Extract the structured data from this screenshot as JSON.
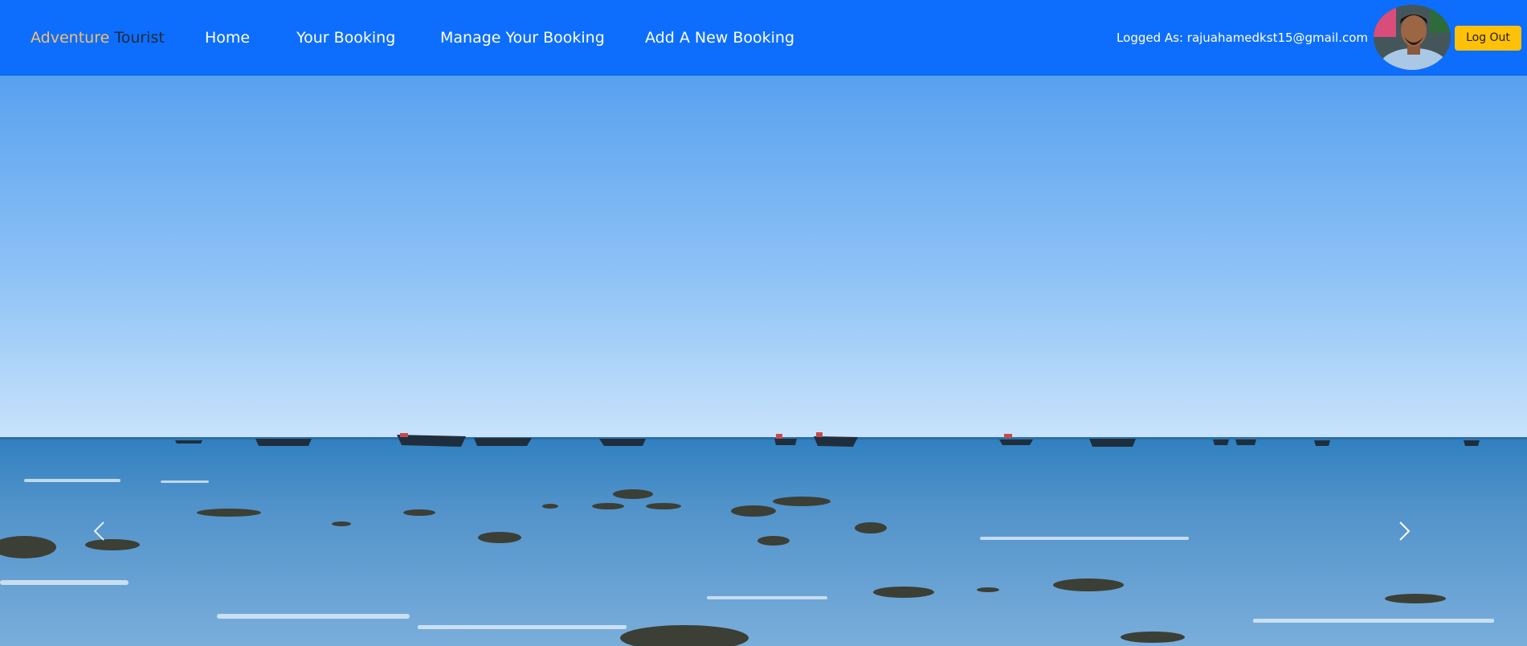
{
  "nav": {
    "brand_part1": "Adventure",
    "brand_part2": "Tourist",
    "links": [
      "Home",
      "Your Booking",
      "Manage Your Booking",
      "Add A New Booking"
    ],
    "logged_label": "Logged As: rajuahamedkst15@gmail.com",
    "logout_label": "Log Out"
  },
  "hero": {
    "image": "beach-sea-boats-photo",
    "prev_icon": "chevron-left-icon",
    "next_icon": "chevron-right-icon"
  },
  "colors": {
    "navbar": "#0d6efd",
    "brand_accent": "#f4c06b",
    "logout_button": "#ffc107"
  }
}
